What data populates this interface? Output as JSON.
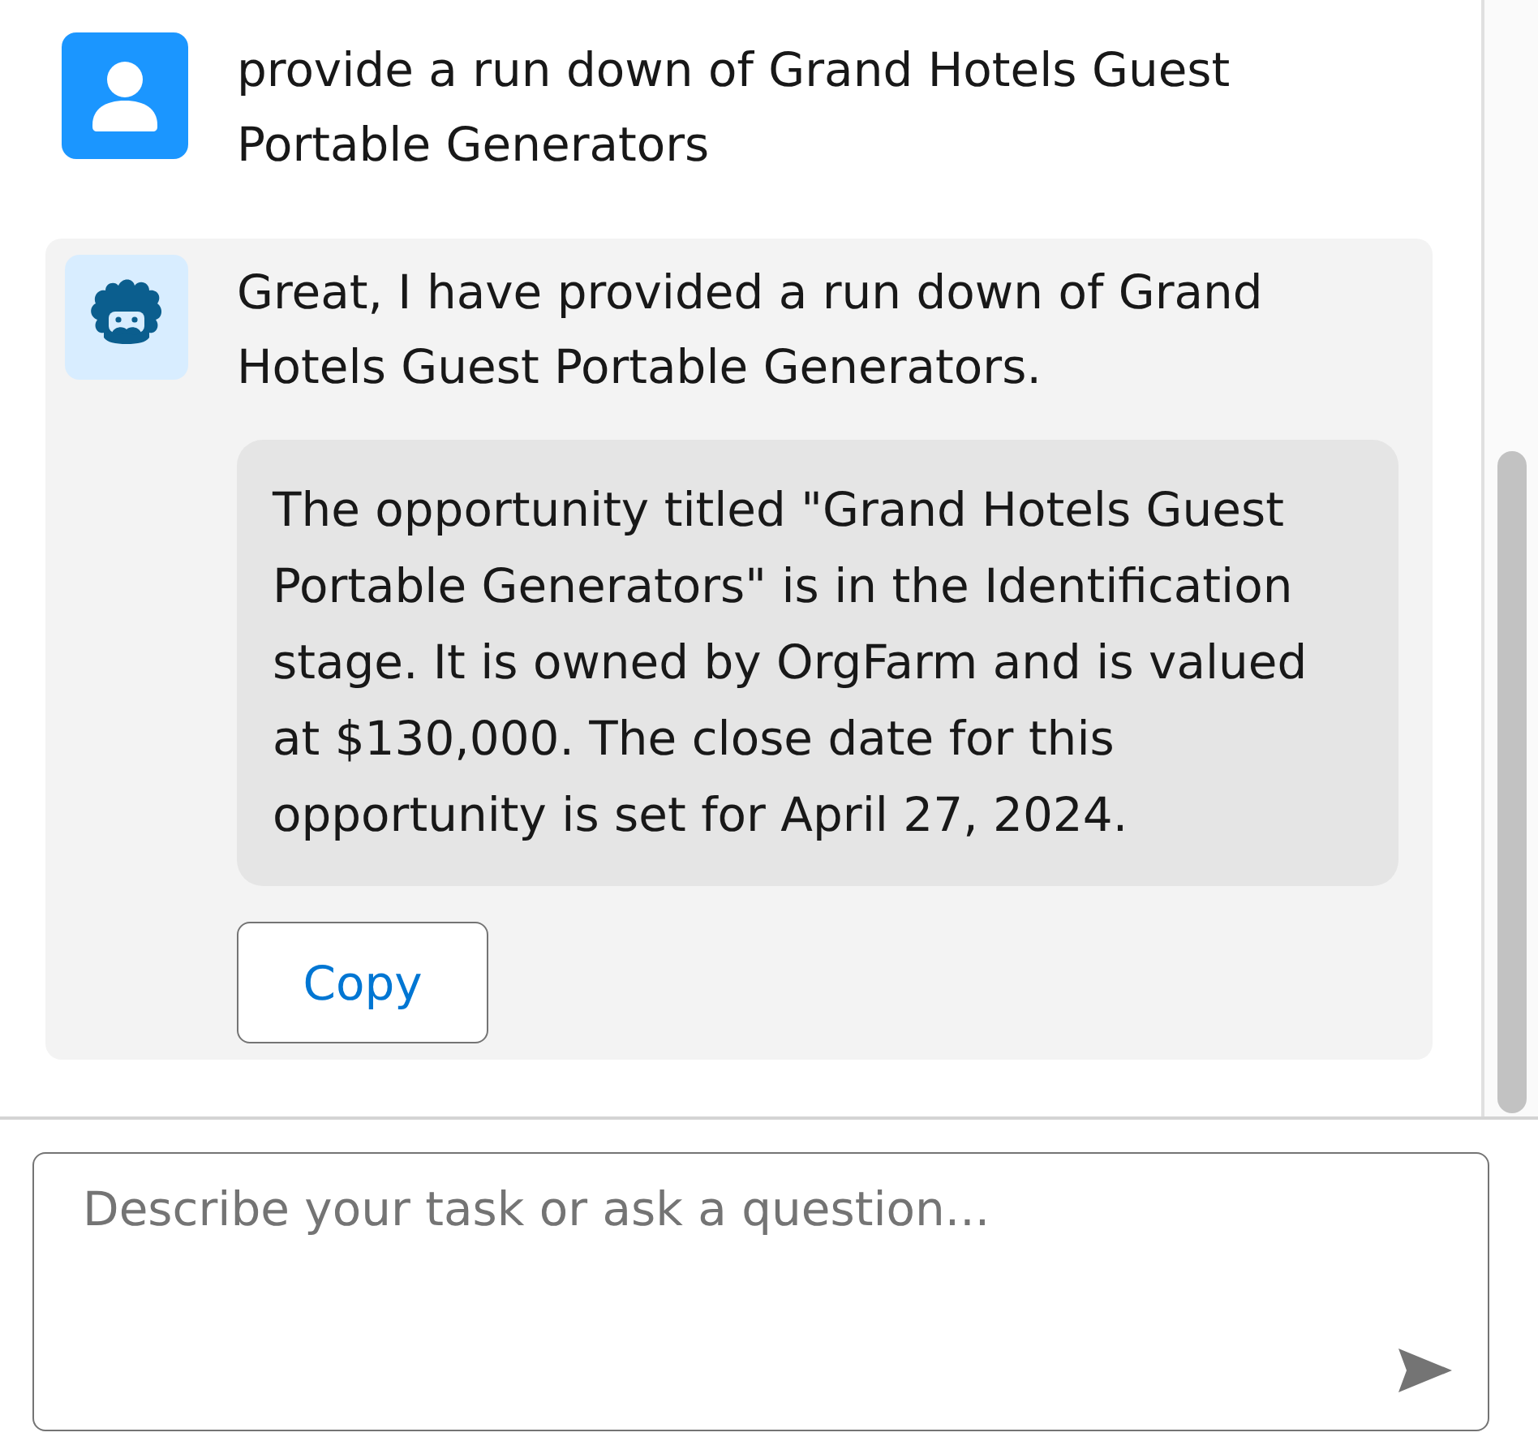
{
  "messages": [
    {
      "kind": "user",
      "text": "provide a run down of Grand Hotels Guest Portable Generators"
    },
    {
      "kind": "bot",
      "text": "Great, I have provided a run down of Grand Hotels Guest Portable Generators.",
      "summary": "The opportunity titled \"Grand Hotels Guest Portable Generators\" is in the Identification stage. It is owned by OrgFarm and is valued at $130,000. The close date for this opportunity is set for April 27, 2024.",
      "actions": [
        "Copy"
      ]
    }
  ],
  "composer": {
    "placeholder": "Describe your task or ask a question..."
  }
}
